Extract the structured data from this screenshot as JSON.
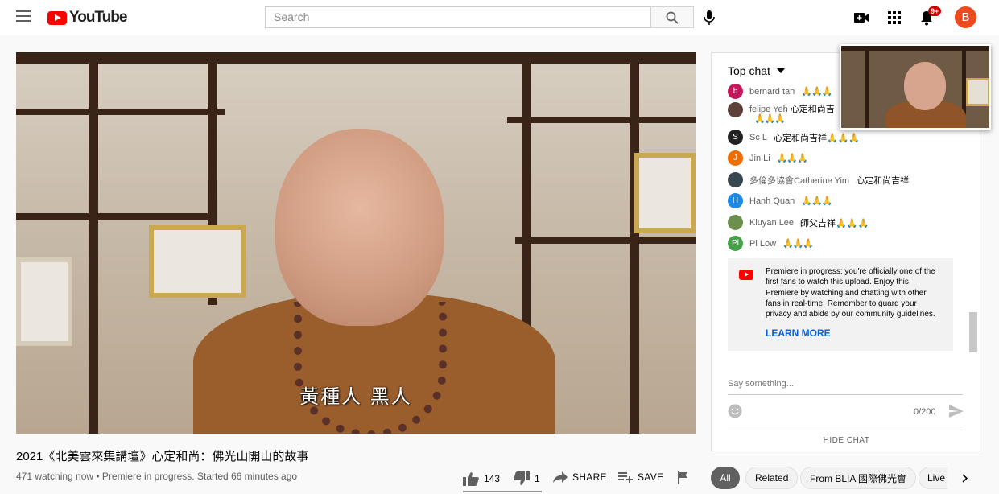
{
  "header": {
    "logo_text": "YouTube",
    "search_placeholder": "Search",
    "notification_count": "9+",
    "avatar_letter": "B"
  },
  "video": {
    "subtitle": "黃種人 黑人",
    "title": "2021《北美雲來集講壇》心定和尚：佛光山開山的故事",
    "meta": "471 watching now • Premiere in progress. Started 66 minutes ago",
    "likes": "143",
    "dislikes": "1",
    "share_label": "SHARE",
    "save_label": "SAVE"
  },
  "chat": {
    "header": "Top chat",
    "messages": [
      {
        "author": "bernard tan",
        "text": "🙏🙏🙏",
        "initial": "b",
        "color": "#c2185b"
      },
      {
        "author": "felipe Yeh",
        "text": "心定和尚吉",
        "initial": "",
        "color": "#5d4037",
        "second_line": "🙏🙏🙏"
      },
      {
        "author": "Sc L",
        "text": "心定和尚吉祥🙏🙏🙏",
        "initial": "S",
        "color": "#212121"
      },
      {
        "author": "Jin Li",
        "text": "🙏🙏🙏",
        "initial": "J",
        "color": "#ef6c00"
      },
      {
        "author": "多倫多協會Catherine Yim",
        "text": "心定和尚吉祥",
        "initial": "",
        "color": "#37474f"
      },
      {
        "author": "Hanh Quan",
        "text": "🙏🙏🙏",
        "initial": "H",
        "color": "#1e88e5"
      },
      {
        "author": "Kiuyan Lee",
        "text": "師父吉祥🙏🙏🙏",
        "initial": "",
        "color": "#6d8f4e"
      },
      {
        "author": "Pl Low",
        "text": "🙏🙏🙏",
        "initial": "Pl",
        "color": "#43a047"
      }
    ],
    "notice": "Premiere in progress: you're officially one of the first fans to watch this upload. Enjoy this Premiere by watching and chatting with other fans in real-time. Remember to guard your privacy and abide by our community guidelines.",
    "learn_more": "LEARN MORE",
    "input_placeholder": "Say something...",
    "counter": "0/200",
    "hide_chat": "HIDE CHAT"
  },
  "chips": [
    "All",
    "Related",
    "From BLIA 國際佛光會",
    "Live"
  ]
}
